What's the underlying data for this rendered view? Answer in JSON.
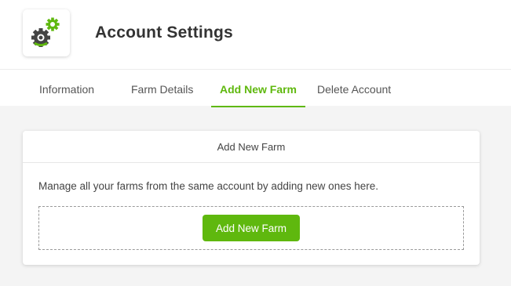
{
  "header": {
    "title": "Account Settings",
    "logo_icon": "gears-icon",
    "accent_color": "#5fb80e"
  },
  "tabs": [
    {
      "label": "Information",
      "active": false
    },
    {
      "label": "Farm Details",
      "active": false
    },
    {
      "label": "Add New Farm",
      "active": true
    },
    {
      "label": "Delete Account",
      "active": false
    }
  ],
  "card": {
    "title": "Add New Farm",
    "description": "Manage all your farms from the same account by adding new ones here.",
    "button_label": "Add New Farm"
  }
}
